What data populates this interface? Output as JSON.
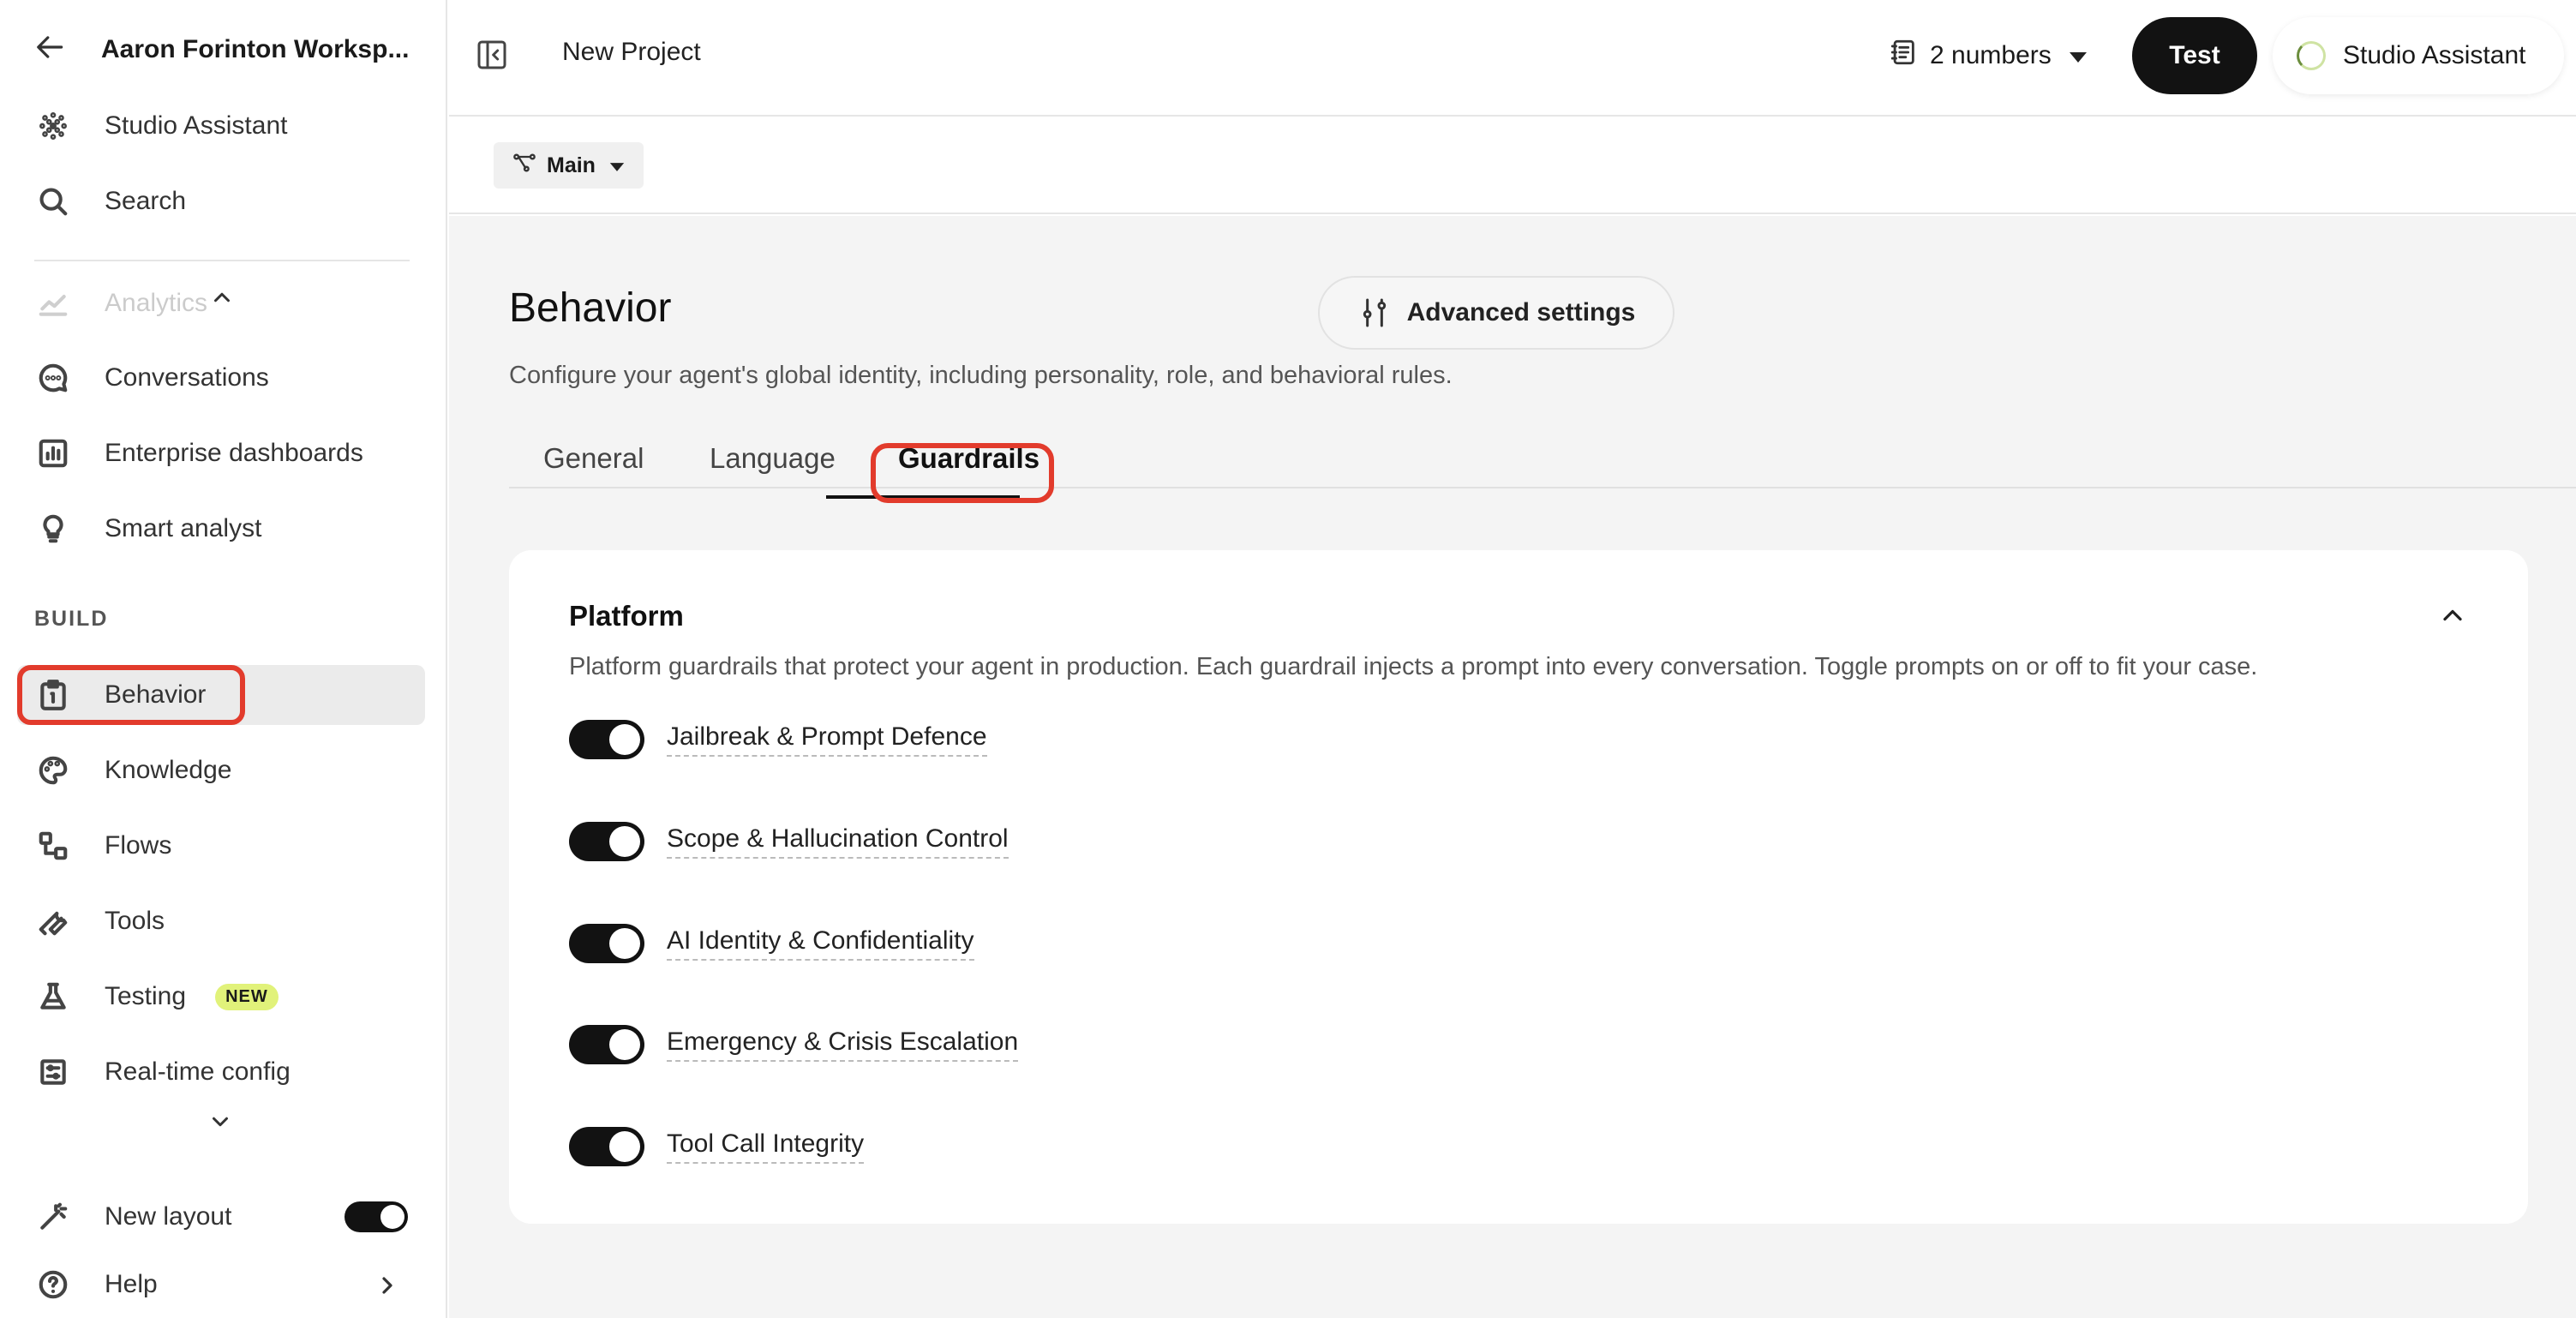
{
  "workspace": {
    "name": "Aaron Forinton Worksp..."
  },
  "sidebar": {
    "top_items": [
      {
        "label": "Studio Assistant"
      },
      {
        "label": "Search"
      }
    ],
    "analytics_label": "Analytics",
    "items": [
      {
        "label": "Conversations"
      },
      {
        "label": "Enterprise dashboards"
      },
      {
        "label": "Smart analyst"
      }
    ],
    "section_label": "BUILD",
    "build_items": [
      {
        "label": "Behavior",
        "active": true
      },
      {
        "label": "Knowledge"
      },
      {
        "label": "Flows"
      },
      {
        "label": "Tools"
      },
      {
        "label": "Testing",
        "badge": "NEW"
      },
      {
        "label": "Real-time config"
      }
    ],
    "new_layout_label": "New layout",
    "help_label": "Help"
  },
  "topbar": {
    "project_title": "New Project",
    "numbers_label": "2 numbers",
    "test_label": "Test",
    "assistant_label": "Studio Assistant"
  },
  "subbar": {
    "branch_label": "Main"
  },
  "page": {
    "title": "Behavior",
    "description": "Configure your agent's global identity, including personality, role, and behavioral rules.",
    "advanced_settings_label": "Advanced settings",
    "tabs": [
      {
        "label": "General"
      },
      {
        "label": "Language"
      },
      {
        "label": "Guardrails",
        "active": true
      }
    ]
  },
  "platform_card": {
    "title": "Platform",
    "description": "Platform guardrails that protect your agent in production. Each guardrail injects a prompt into every conversation. Toggle prompts on or off to fit your case.",
    "guardrails": [
      {
        "label": "Jailbreak & Prompt Defence",
        "enabled": true
      },
      {
        "label": "Scope & Hallucination Control",
        "enabled": true
      },
      {
        "label": "AI Identity & Confidentiality",
        "enabled": true
      },
      {
        "label": "Emergency & Crisis Escalation",
        "enabled": true
      },
      {
        "label": "Tool Call Integrity",
        "enabled": true
      }
    ]
  },
  "colors": {
    "accent_dark": "#121212",
    "highlight_red": "#e23b2c",
    "badge_new": "#e1f27a",
    "main_bg": "#f4f4f4"
  }
}
